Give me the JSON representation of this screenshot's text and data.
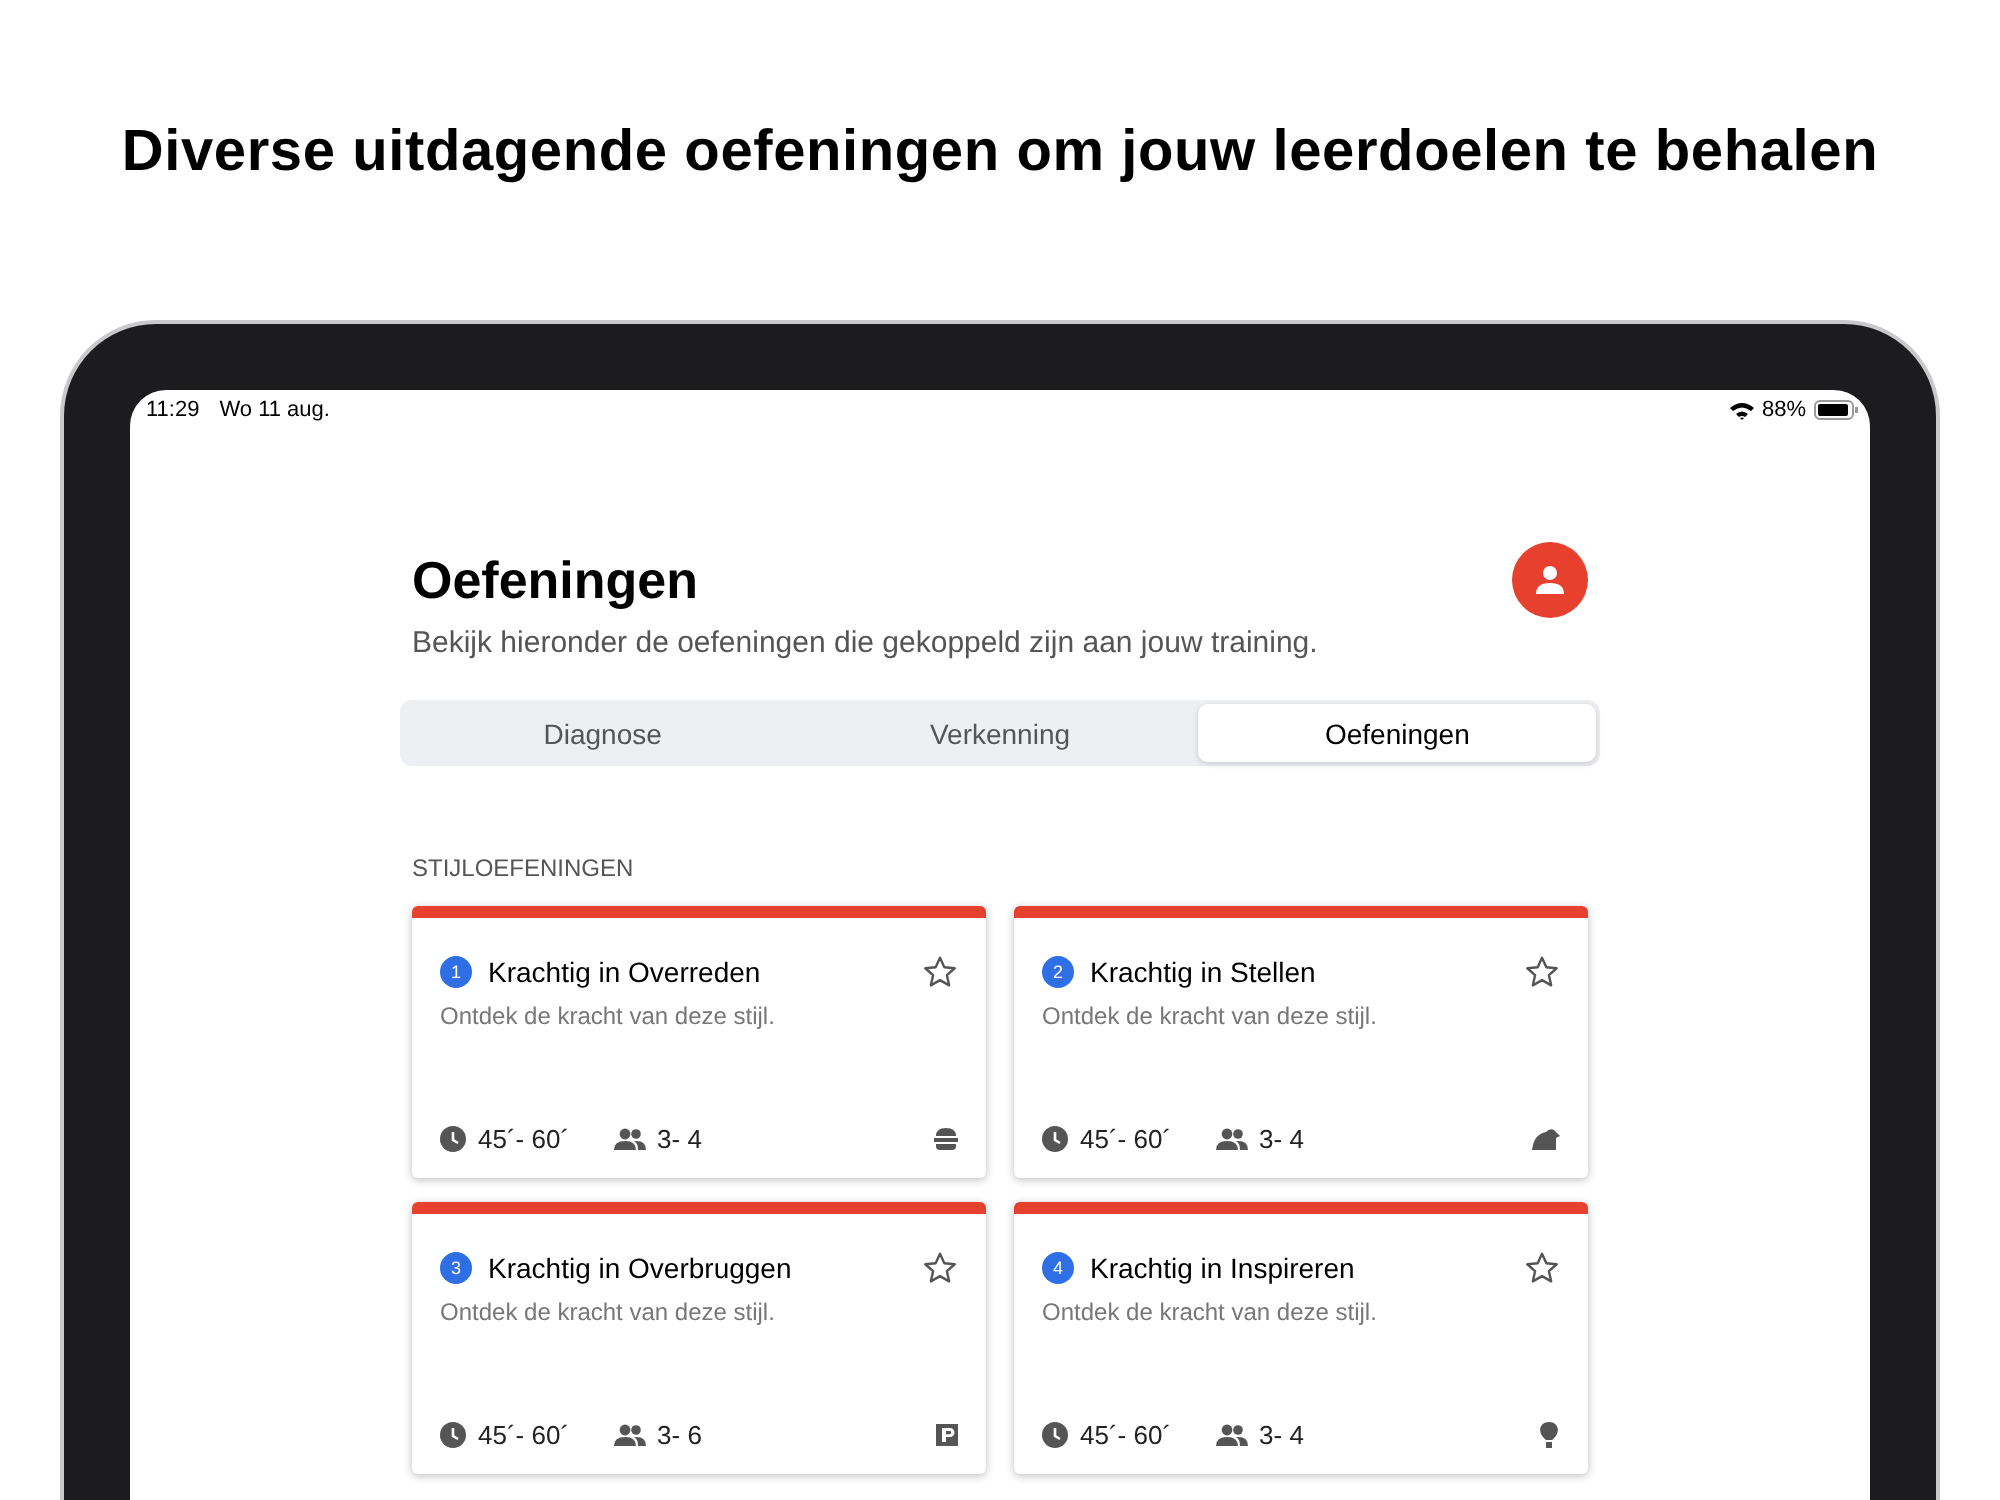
{
  "headline": "Diverse uitdagende oefeningen om jouw leerdoelen te behalen",
  "status_bar": {
    "time": "11:29",
    "date": "Wo 11 aug.",
    "battery": "88%"
  },
  "page": {
    "title": "Oefeningen",
    "subtitle": "Bekijk hieronder de oefeningen die gekoppeld zijn aan jouw training."
  },
  "tabs": [
    {
      "label": "Diagnose",
      "selected": false
    },
    {
      "label": "Verkenning",
      "selected": false
    },
    {
      "label": "Oefeningen",
      "selected": true
    }
  ],
  "section": {
    "title": "STIJLOEFENINGEN"
  },
  "cards": [
    {
      "number": "1",
      "title": "Krachtig in Overreden",
      "description": "Ontdek de kracht van deze stijl.",
      "duration": "45´- 60´",
      "group": "3- 4",
      "favorite": false,
      "kind": "burger"
    },
    {
      "number": "2",
      "title": "Krachtig in Stellen",
      "description": "Ontdek de kracht van deze stijl.",
      "duration": "45´- 60´",
      "group": "3- 4",
      "favorite": false,
      "kind": "animal"
    },
    {
      "number": "3",
      "title": "Krachtig in Overbruggen",
      "description": "Ontdek de kracht van deze stijl.",
      "duration": "45´- 60´",
      "group": "3- 6",
      "favorite": false,
      "kind": "sign"
    },
    {
      "number": "4",
      "title": "Krachtig in Inspireren",
      "description": "Ontdek de kracht van deze stijl.",
      "duration": "45´- 60´",
      "group": "3- 4",
      "favorite": false,
      "kind": "balloon"
    }
  ]
}
